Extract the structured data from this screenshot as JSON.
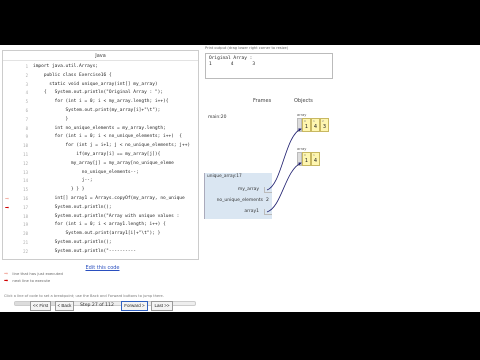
{
  "code": {
    "header": "Java",
    "lines": [
      {
        "n": "1",
        "text": "import java.util.Arrays;"
      },
      {
        "n": "2",
        "text": "    public class Exercise16 {"
      },
      {
        "n": "3",
        "text": "      static void unique_array(int[] my_array)"
      },
      {
        "n": "4",
        "text": "    {   System.out.println(\"Original Array : \");"
      },
      {
        "n": "5",
        "text": "        for (int i = 0; i < my_array.length; i++){"
      },
      {
        "n": "6",
        "text": "            System.out.print(my_array[i]+\"\\t\");"
      },
      {
        "n": "7",
        "text": "            }"
      },
      {
        "n": "8",
        "text": "        int no_unique_elements = my_array.length;"
      },
      {
        "n": "9",
        "text": "        for (int i = 0; i < no_unique_elements; i++)  {"
      },
      {
        "n": "10",
        "text": "            for (int j = i+1; j < no_unique_elements; j++)"
      },
      {
        "n": "11",
        "text": "                if(my_array[i] == my_array[j]){"
      },
      {
        "n": "12",
        "text": "              my_array[j] = my_array[no_unique_eleme"
      },
      {
        "n": "13",
        "text": "                  no_unique_elements--;"
      },
      {
        "n": "14",
        "text": "                  j--;"
      },
      {
        "n": "15",
        "text": "              } } }"
      },
      {
        "n": "16",
        "text": "        int[] array1 = Arrays.copyOf(my_array, no_unique"
      },
      {
        "n": "17",
        "text": "        System.out.println();"
      },
      {
        "n": "18",
        "text": "        System.out.println(\"Array with unique values :"
      },
      {
        "n": "19",
        "text": "        for (int i = 0; i < array1.length; i++) {"
      },
      {
        "n": "20",
        "text": "            System.out.print(array1[i]+\"\\t\"); }"
      },
      {
        "n": "21",
        "text": "        System.out.println();"
      },
      {
        "n": "22",
        "text": "        System.out.println(\"----------"
      }
    ],
    "prev_line": "16",
    "next_line": "17"
  },
  "edit_link": "Edit this code",
  "legend": {
    "prev": "line that has just executed",
    "next": "next line to execute"
  },
  "hint": "Click a line of code to set a breakpoint; use the Back and Forward buttons to jump there.",
  "progress": {
    "step": 27,
    "total": 112
  },
  "controls": {
    "first": "<< First",
    "back": "< Back",
    "step_text": "Step 27 of 112",
    "forward": "Forward >",
    "last": "Last >>"
  },
  "output": {
    "caption": "Print output (drag lower right corner to resize)",
    "text": "Original Array :\n1\t4\t3"
  },
  "viz": {
    "frames_header": "Frames",
    "objects_header": "Objects",
    "main_frame": "main:20",
    "frame_title": "unique_array:17",
    "vars": {
      "my_array": "my_array",
      "no_unique_elements": "no_unique_elements",
      "no_unique_value": "2",
      "array1": "array1"
    },
    "array_label": "array",
    "obj1": {
      "indices": [
        "0",
        "1",
        "2"
      ],
      "values": [
        "1",
        "4",
        "3"
      ]
    },
    "obj2": {
      "indices": [
        "0",
        "1"
      ],
      "values": [
        "1",
        "4"
      ]
    }
  },
  "colors": {
    "prev_arrow": "#f3b3a8",
    "next_arrow": "#d00000",
    "frame_bg": "#dae6f2",
    "cell_bg": "#fef6b0",
    "link": "#2a4fbf"
  }
}
